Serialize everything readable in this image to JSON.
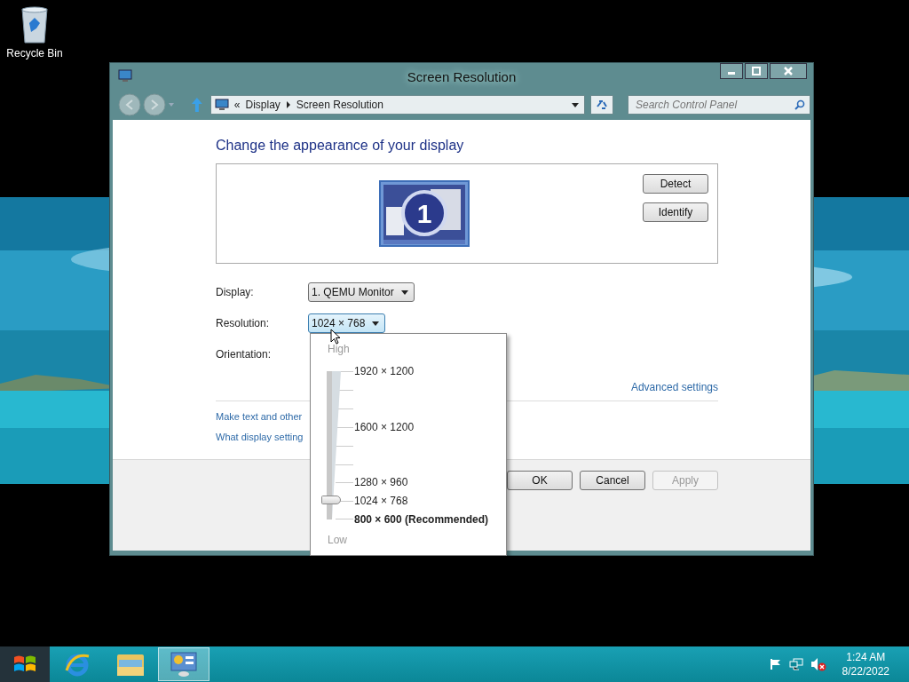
{
  "desktop": {
    "icons": [
      {
        "label": "Recycle Bin"
      }
    ]
  },
  "window": {
    "title": "Screen Resolution",
    "address": {
      "overflow": "«",
      "crumbs": [
        "Display",
        "Screen Resolution"
      ]
    },
    "search": {
      "placeholder": "Search Control Panel"
    },
    "heading": "Change the appearance of your display",
    "monitor": {
      "number": "1"
    },
    "side_buttons": [
      "Detect",
      "Identify"
    ],
    "settings": [
      {
        "label": "Display:",
        "value": "1. QEMU Monitor",
        "open": false
      },
      {
        "label": "Resolution:",
        "value": "1024 × 768",
        "open": true
      },
      {
        "label": "Orientation:"
      }
    ],
    "advanced_link": "Advanced settings",
    "links": [
      "Make text and other",
      "What display setting"
    ],
    "footer_buttons": [
      {
        "label": "OK",
        "disabled": false
      },
      {
        "label": "Cancel",
        "disabled": false
      },
      {
        "label": "Apply",
        "disabled": true
      }
    ]
  },
  "resolution_menu": {
    "high_label": "High",
    "low_label": "Low",
    "slider": {
      "level": 0.13
    },
    "options": [
      {
        "label": "1920 × 1200",
        "recommended": false
      },
      {
        "label": "1600 × 1200",
        "recommended": false
      },
      {
        "label": "1280 × 960",
        "recommended": false
      },
      {
        "label": "1024 × 768",
        "recommended": false
      },
      {
        "label": "800 × 600 (Recommended)",
        "recommended": true
      }
    ]
  },
  "taskbar": {
    "apps": [
      {
        "kind": "browser",
        "active": false
      },
      {
        "kind": "files",
        "active": false
      },
      {
        "kind": "control_panel",
        "active": true
      }
    ],
    "tray": {
      "volume_muted": true
    },
    "clock": {
      "time": "1:24 AM",
      "date": "8/22/2022"
    }
  }
}
